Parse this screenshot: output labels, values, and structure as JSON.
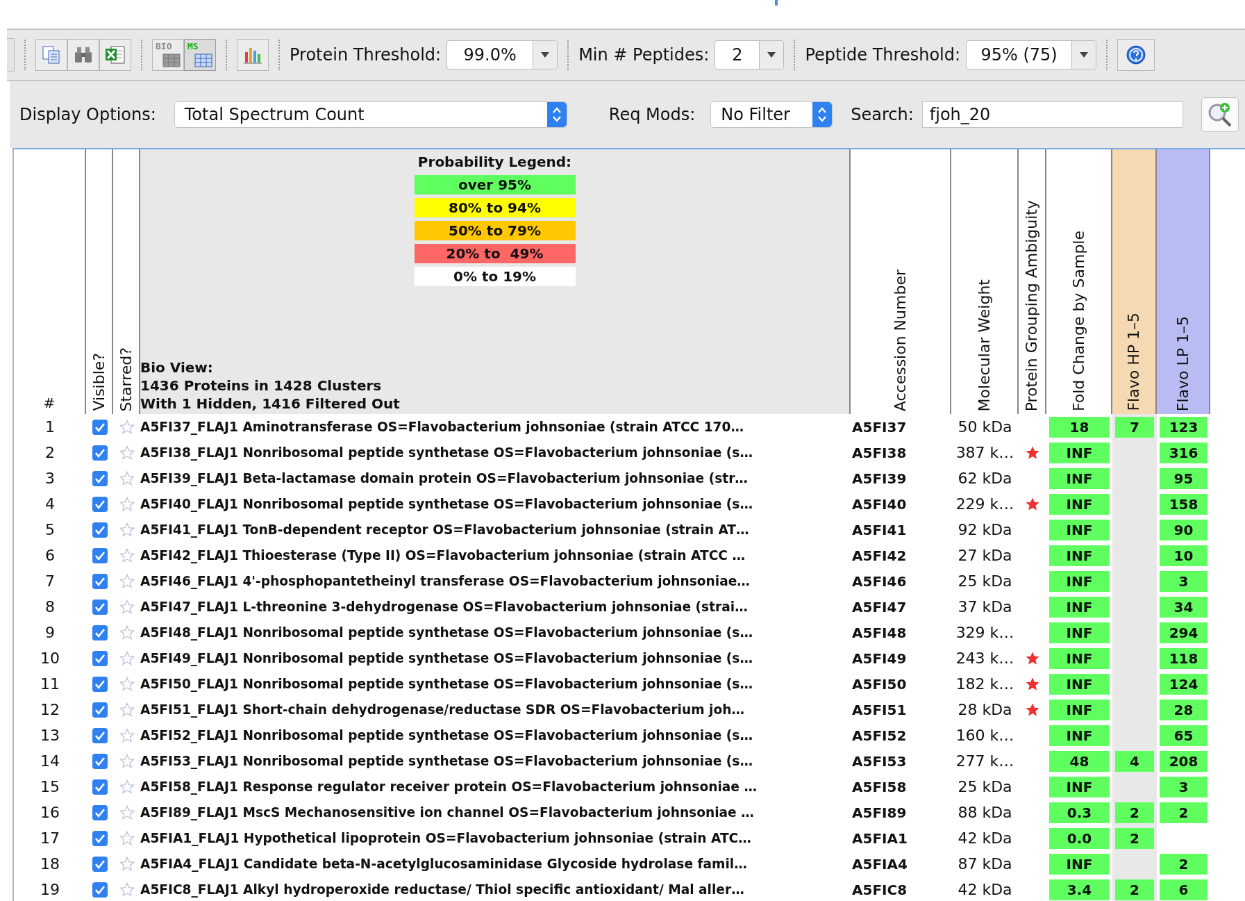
{
  "toolbar": {
    "buttons": [
      {
        "kind": "copy"
      },
      {
        "kind": "find"
      },
      {
        "kind": "excel"
      },
      {
        "kind": "grid",
        "label": "BIO",
        "selected": false
      },
      {
        "kind": "grid",
        "label": "MS",
        "selected": true
      },
      {
        "kind": "chart"
      }
    ],
    "protein_threshold": {
      "label": "Protein Threshold:",
      "value": "99.0%"
    },
    "min_peptides": {
      "label": "Min # Peptides:",
      "value": "2"
    },
    "peptide_threshold": {
      "label": "Peptide Threshold:",
      "value": "95% (75)"
    }
  },
  "options": {
    "display": {
      "label": "Display Options:",
      "value": "Total Spectrum Count"
    },
    "req_mods": {
      "label": "Req Mods:",
      "value": "No Filter"
    },
    "search": {
      "label": "Search:",
      "value": "fjoh_20"
    }
  },
  "header": {
    "number": "#",
    "visible": "Visible?",
    "starred": "Starred?",
    "legend": {
      "title": "Probability Legend:",
      "items": [
        {
          "label": "over 95%",
          "color": "#5eff5e"
        },
        {
          "label": "80% to 94%",
          "color": "#ffff00"
        },
        {
          "label": "50% to 79%",
          "color": "#ffc800"
        },
        {
          "label": "20% to  49%",
          "color": "#ff6666"
        },
        {
          "label": "0% to 19%",
          "color": "#ffffff"
        }
      ]
    },
    "bio_view": [
      "Bio View:",
      "1436 Proteins in 1428 Clusters",
      "With 1 Hidden, 1416 Filtered Out"
    ],
    "accession": "Accession Number",
    "weight": "Molecular Weight",
    "ambiguity": "Protein Grouping Ambiguity",
    "fold": "Fold Change by Sample",
    "samples": [
      {
        "label": "Flavo HP 1–5",
        "color": "#f5d9b3"
      },
      {
        "label": "Flavo LP 1–5",
        "color": "#b8bcf3"
      }
    ]
  },
  "rows": [
    {
      "num": "1",
      "visible": true,
      "starred": false,
      "name": "A5FI37_FLAJ1 Aminotransferase OS=Flavobacterium johnsoniae (strain ATCC 170…",
      "accession": "A5FI37",
      "weight": "50 kDa",
      "ambiguous": false,
      "fold": "18",
      "hp": "7",
      "lp": "123"
    },
    {
      "num": "2",
      "visible": true,
      "starred": false,
      "name": "A5FI38_FLAJ1 Nonribosomal peptide synthetase OS=Flavobacterium johnsoniae (s…",
      "accession": "A5FI38",
      "weight": "387 k…",
      "ambiguous": true,
      "fold": "INF",
      "lp": "316"
    },
    {
      "num": "3",
      "visible": true,
      "starred": false,
      "name": "A5FI39_FLAJ1 Beta-lactamase domain protein OS=Flavobacterium johnsoniae (str…",
      "accession": "A5FI39",
      "weight": "62 kDa",
      "ambiguous": false,
      "fold": "INF",
      "lp": "95"
    },
    {
      "num": "4",
      "visible": true,
      "starred": false,
      "name": "A5FI40_FLAJ1 Nonribosomal peptide synthetase OS=Flavobacterium johnsoniae (s…",
      "accession": "A5FI40",
      "weight": "229 k…",
      "ambiguous": true,
      "fold": "INF",
      "lp": "158"
    },
    {
      "num": "5",
      "visible": true,
      "starred": false,
      "name": "A5FI41_FLAJ1 TonB-dependent receptor OS=Flavobacterium johnsoniae (strain AT…",
      "accession": "A5FI41",
      "weight": "92 kDa",
      "ambiguous": false,
      "fold": "INF",
      "lp": "90"
    },
    {
      "num": "6",
      "visible": true,
      "starred": false,
      "name": "A5FI42_FLAJ1 Thioesterase (Type II) OS=Flavobacterium johnsoniae (strain ATCC …",
      "accession": "A5FI42",
      "weight": "27 kDa",
      "ambiguous": false,
      "fold": "INF",
      "lp": "10"
    },
    {
      "num": "7",
      "visible": true,
      "starred": false,
      "name": "A5FI46_FLAJ1 4'-phosphopantetheinyl transferase OS=Flavobacterium johnsoniae…",
      "accession": "A5FI46",
      "weight": "25 kDa",
      "ambiguous": false,
      "fold": "INF",
      "lp": "3"
    },
    {
      "num": "8",
      "visible": true,
      "starred": false,
      "name": "A5FI47_FLAJ1 L-threonine 3-dehydrogenase OS=Flavobacterium johnsoniae (strai…",
      "accession": "A5FI47",
      "weight": "37 kDa",
      "ambiguous": false,
      "fold": "INF",
      "lp": "34"
    },
    {
      "num": "9",
      "visible": true,
      "starred": false,
      "name": "A5FI48_FLAJ1 Nonribosomal peptide synthetase OS=Flavobacterium johnsoniae (s…",
      "accession": "A5FI48",
      "weight": "329 k…",
      "ambiguous": false,
      "fold": "INF",
      "lp": "294"
    },
    {
      "num": "10",
      "visible": true,
      "starred": false,
      "name": "A5FI49_FLAJ1 Nonribosomal peptide synthetase OS=Flavobacterium johnsoniae (s…",
      "accession": "A5FI49",
      "weight": "243 k…",
      "ambiguous": true,
      "fold": "INF",
      "lp": "118"
    },
    {
      "num": "11",
      "visible": true,
      "starred": false,
      "name": "A5FI50_FLAJ1 Nonribosomal peptide synthetase OS=Flavobacterium johnsoniae (s…",
      "accession": "A5FI50",
      "weight": "182 k…",
      "ambiguous": true,
      "fold": "INF",
      "lp": "124"
    },
    {
      "num": "12",
      "visible": true,
      "starred": false,
      "name": "A5FI51_FLAJ1 Short-chain dehydrogenase/reductase SDR OS=Flavobacterium joh…",
      "accession": "A5FI51",
      "weight": "28 kDa",
      "ambiguous": true,
      "fold": "INF",
      "lp": "28"
    },
    {
      "num": "13",
      "visible": true,
      "starred": false,
      "name": "A5FI52_FLAJ1 Nonribosomal peptide synthetase OS=Flavobacterium johnsoniae (s…",
      "accession": "A5FI52",
      "weight": "160 k…",
      "ambiguous": false,
      "fold": "INF",
      "lp": "65"
    },
    {
      "num": "14",
      "visible": true,
      "starred": false,
      "name": "A5FI53_FLAJ1 Nonribosomal peptide synthetase OS=Flavobacterium johnsoniae (s…",
      "accession": "A5FI53",
      "weight": "277 k…",
      "ambiguous": false,
      "fold": "48",
      "hp": "4",
      "lp": "208"
    },
    {
      "num": "15",
      "visible": true,
      "starred": false,
      "name": "A5FI58_FLAJ1 Response regulator receiver protein OS=Flavobacterium johnsoniae …",
      "accession": "A5FI58",
      "weight": "25 kDa",
      "ambiguous": false,
      "fold": "INF",
      "lp": "3"
    },
    {
      "num": "16",
      "visible": true,
      "starred": false,
      "name": "A5FI89_FLAJ1 MscS Mechanosensitive ion channel OS=Flavobacterium johnsoniae …",
      "accession": "A5FI89",
      "weight": "88 kDa",
      "ambiguous": false,
      "fold": "0.3",
      "hp": "2",
      "lp": "2"
    },
    {
      "num": "17",
      "visible": true,
      "starred": false,
      "name": "A5FIA1_FLAJ1 Hypothetical lipoprotein OS=Flavobacterium johnsoniae (strain ATC…",
      "accession": "A5FIA1",
      "weight": "42 kDa",
      "ambiguous": false,
      "fold": "0.0",
      "hp": "2"
    },
    {
      "num": "18",
      "visible": true,
      "starred": false,
      "name": "A5FIA4_FLAJ1 Candidate beta-N-acetylglucosaminidase Glycoside hydrolase famil…",
      "accession": "A5FIA4",
      "weight": "87 kDa",
      "ambiguous": false,
      "fold": "INF",
      "lp": "2"
    },
    {
      "num": "19",
      "visible": true,
      "starred": false,
      "name": "A5FIC8_FLAJ1 Alkyl hydroperoxide reductase/ Thiol specific antioxidant/ Mal aller…",
      "accession": "A5FIC8",
      "weight": "42 kDa",
      "ambiguous": false,
      "fold": "3.4",
      "hp": "2",
      "lp": "6"
    }
  ]
}
